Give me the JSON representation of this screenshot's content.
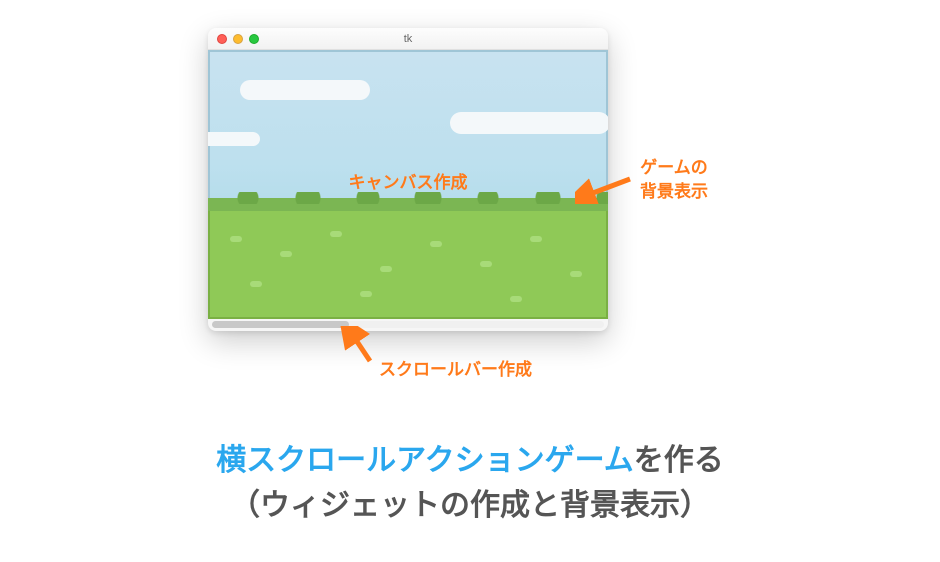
{
  "window": {
    "title": "tk"
  },
  "labels": {
    "canvas": "キャンバス作成",
    "background": "ゲームの\n背景表示",
    "scrollbar": "スクロールバー作成"
  },
  "heading": {
    "blue": "横スクロールアクションゲーム",
    "rest": "を作る",
    "sub": "（ウィジェットの作成と背景表示）"
  }
}
